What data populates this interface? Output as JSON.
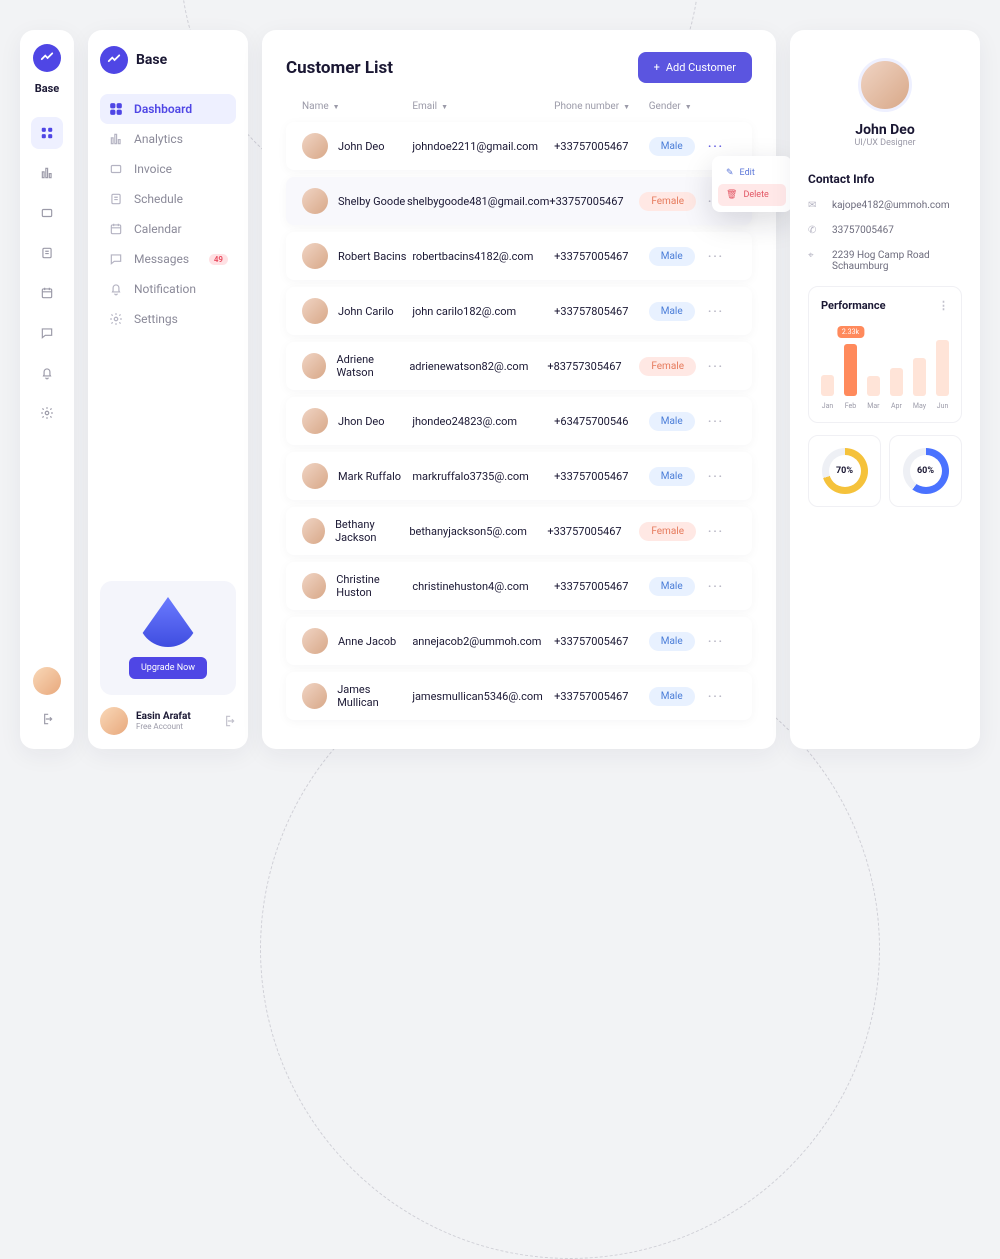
{
  "brand": "Base",
  "rail": {
    "items": [
      "dashboard",
      "analytics",
      "invoice",
      "schedule",
      "calendar",
      "messages",
      "notification",
      "settings"
    ]
  },
  "sidebar": {
    "items": [
      {
        "label": "Dashboard",
        "icon": "grid",
        "active": true
      },
      {
        "label": "Analytics",
        "icon": "chart"
      },
      {
        "label": "Invoice",
        "icon": "ticket"
      },
      {
        "label": "Schedule",
        "icon": "note"
      },
      {
        "label": "Calendar",
        "icon": "cal"
      },
      {
        "label": "Messages",
        "icon": "msg",
        "badge": "49"
      },
      {
        "label": "Notification",
        "icon": "bell"
      },
      {
        "label": "Settings",
        "icon": "gear"
      }
    ],
    "upgrade_label": "Upgrade Now",
    "account": {
      "name": "Easin Arafat",
      "plan": "Free Account"
    }
  },
  "page": {
    "title": "Customer List",
    "add_label": "Add Customer"
  },
  "columns": {
    "name": "Name",
    "email": "Email",
    "phone": "Phone number",
    "gender": "Gender"
  },
  "menu": {
    "edit": "Edit",
    "delete": "Delete"
  },
  "customers": [
    {
      "name": "John Deo",
      "email": "johndoe2211@gmail.com",
      "phone": "+33757005467",
      "gender": "Male"
    },
    {
      "name": "Shelby Goode",
      "email": "shelbygoode481@gmail.com",
      "phone": "+33757005467",
      "gender": "Female",
      "selected": true
    },
    {
      "name": "Robert Bacins",
      "email": "robertbacins4182@.com",
      "phone": "+33757005467",
      "gender": "Male"
    },
    {
      "name": "John Carilo",
      "email": "john carilo182@.com",
      "phone": "+33757805467",
      "gender": "Male"
    },
    {
      "name": "Adriene Watson",
      "email": "adrienewatson82@.com",
      "phone": "+83757305467",
      "gender": "Female"
    },
    {
      "name": "Jhon Deo",
      "email": "jhondeo24823@.com",
      "phone": "+63475700546",
      "gender": "Male"
    },
    {
      "name": "Mark Ruffalo",
      "email": "markruffalo3735@.com",
      "phone": "+33757005467",
      "gender": "Male"
    },
    {
      "name": "Bethany Jackson",
      "email": "bethanyjackson5@.com",
      "phone": "+33757005467",
      "gender": "Female"
    },
    {
      "name": "Christine Huston",
      "email": "christinehuston4@.com",
      "phone": "+33757005467",
      "gender": "Male"
    },
    {
      "name": "Anne Jacob",
      "email": "annejacob2@ummoh.com",
      "phone": "+33757005467",
      "gender": "Male"
    },
    {
      "name": "James Mullican",
      "email": "jamesmullican5346@.com",
      "phone": "+33757005467",
      "gender": "Male"
    }
  ],
  "detail": {
    "name": "John Deo",
    "role": "UI/UX Designer",
    "contact_title": "Contact Info",
    "email": "kajope4182@ummoh.com",
    "phone": "33757005467",
    "address": "2239  Hog Camp Road Schaumburg",
    "perf_title": "Performance",
    "months": [
      "Jan",
      "Feb",
      "Mar",
      "Apr",
      "May",
      "Jun"
    ],
    "tooltip": "2.33k",
    "ring1": "70%",
    "ring2": "60%"
  },
  "chart_data": {
    "type": "bar",
    "title": "Performance",
    "categories": [
      "Jan",
      "Feb",
      "Mar",
      "Apr",
      "May",
      "Jun"
    ],
    "values": [
      30,
      75,
      28,
      40,
      55,
      80
    ],
    "highlight_index": 1,
    "highlight_label": "2.33k",
    "ylim": [
      0,
      100
    ],
    "donuts": [
      {
        "value": 70,
        "label": "70%",
        "color": "#f5c23b"
      },
      {
        "value": 60,
        "label": "60%",
        "color": "#4a72ff"
      }
    ]
  }
}
